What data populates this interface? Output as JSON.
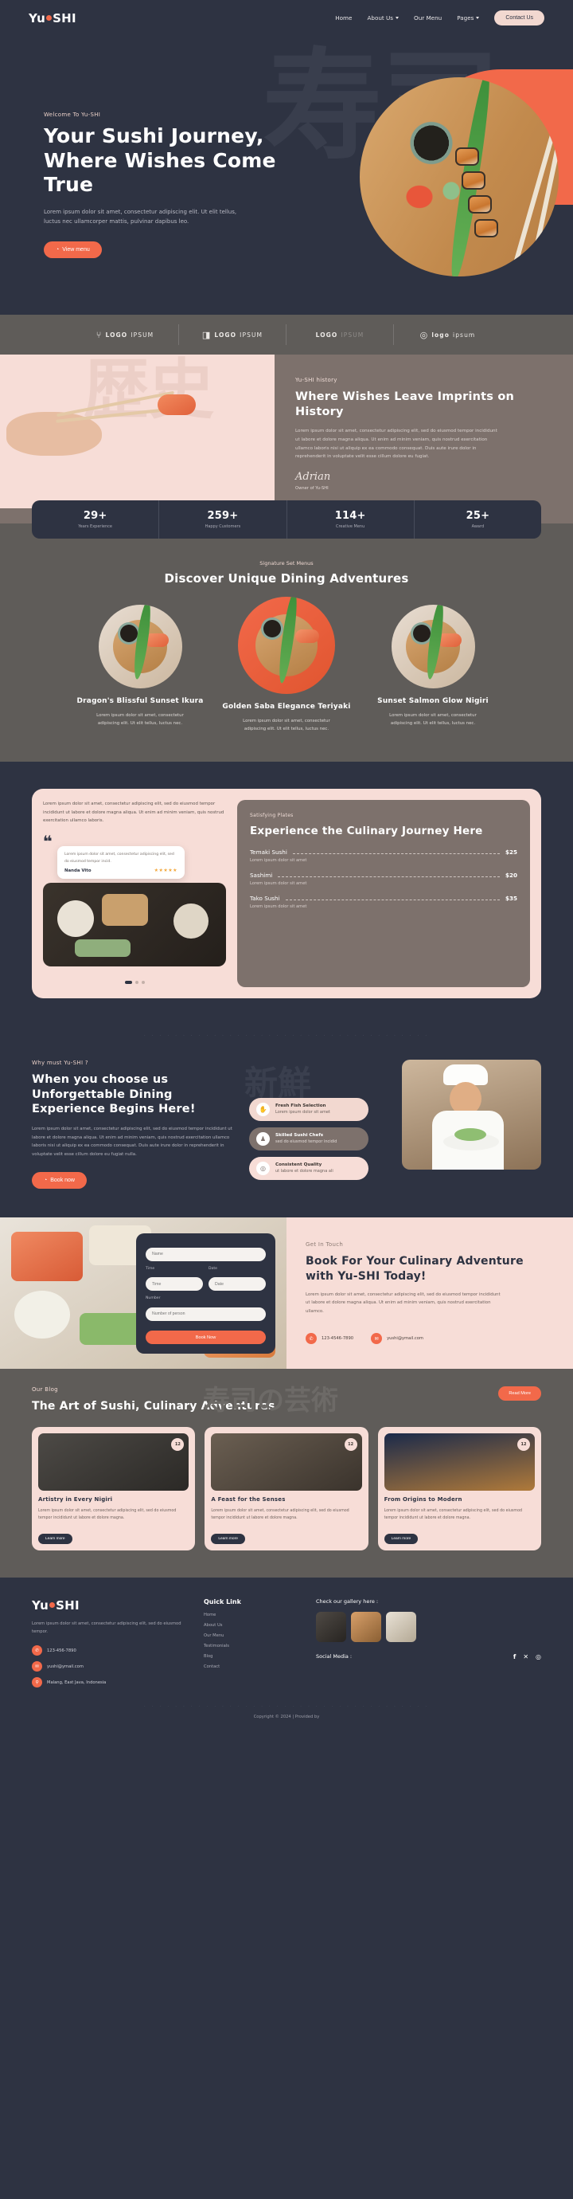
{
  "brand": {
    "pre": "Yu",
    "post": "SHI"
  },
  "nav": {
    "items": [
      {
        "label": "Home",
        "caret": false
      },
      {
        "label": "About Us",
        "caret": true
      },
      {
        "label": "Our Menu",
        "caret": false
      },
      {
        "label": "Pages",
        "caret": true
      }
    ],
    "cta": "Contact Us"
  },
  "hero": {
    "kanji": "寿司",
    "eyebrow": "Welcome To Yu-SHI",
    "title": "Your Sushi Journey, Where Wishes Come True",
    "paragraph": "Lorem ipsum dolor sit amet, consectetur adipiscing elit. Ut elit tellus, luctus nec ullamcorper mattis, pulvinar dapibus leo.",
    "button": "View menu"
  },
  "logos": [
    {
      "mark": "⑂",
      "bold": "LOGO",
      "rest": "IPSUM",
      "faded": false
    },
    {
      "mark": "◨",
      "bold": "LOGO",
      "rest": "IPSUM",
      "faded": false
    },
    {
      "mark": "",
      "bold": "LOGO",
      "rest": "IPSUM",
      "faded": true
    },
    {
      "mark": "◎",
      "bold": "logo",
      "rest": "ipsum",
      "faded": false
    }
  ],
  "history": {
    "kanji": "歴史",
    "eyebrow": "Yu-SHI history",
    "title": "Where Wishes Leave Imprints on History",
    "paragraph": "Lorem ipsum dolor sit amet, consectetur adipiscing elit, sed do eiusmod tempor incididunt ut labore et dolore magna aliqua. Ut enim ad minim veniam, quis nostrud exercitation ullamco laboris nisi ut aliquip ex ea commodo consequat. Duis aute irure dolor in reprehenderit in voluptate velit esse cillum dolore eu fugiat.",
    "signature": "Adrian",
    "owner": "Owner of Yu-SHI"
  },
  "stats": [
    {
      "num": "29+",
      "label": "Years Experience"
    },
    {
      "num": "259+",
      "label": "Happy Customers"
    },
    {
      "num": "114+",
      "label": "Creative Menu"
    },
    {
      "num": "25+",
      "label": "Award"
    }
  ],
  "menu_section": {
    "eyebrow": "Signature Set Menus",
    "title": "Discover Unique Dining Adventures",
    "cards": [
      {
        "title": "Dragon's Blissful Sunset Ikura",
        "text": "Lorem ipsum dolor sit amet, consectetur adipiscing elit. Ut elit tellus, luctus nec."
      },
      {
        "title": "Golden Saba Elegance Teriyaki",
        "text": "Lorem ipsum dolor sit amet, consectetur adipiscing elit. Ut elit tellus, luctus nec."
      },
      {
        "title": "Sunset Salmon Glow Nigiri",
        "text": "Lorem ipsum dolor sit amet, consectetur adipiscing elit. Ut elit tellus, luctus nec."
      }
    ]
  },
  "experience": {
    "lead": "Lorem ipsum dolor sit amet, consectetur adipiscing elit, sed do eiusmod tempor incididunt ut labore et dolore magna aliqua. Ut enim ad minim veniam, quis nostrud exercitation ullamco laboris.",
    "quote_mark": "❝",
    "review_text": "Lorem ipsum dolor sit amet, consectetur adipiscing elit, sed do eiusmod tempor incid.",
    "review_name": "Nanda Vito",
    "stars": "★★★★★",
    "eyebrow": "Satisfying Plates",
    "title": "Experience the Culinary Journey Here",
    "items": [
      {
        "name": "Temaki Sushi",
        "price": "$25",
        "sub": "Lorem ipsum dolor sit amet"
      },
      {
        "name": "Sashimi",
        "price": "$20",
        "sub": "Lorem ipsum dolor sit amet"
      },
      {
        "name": "Tako Sushi",
        "price": "$35",
        "sub": "Lorem ipsum dolor sit amet"
      }
    ]
  },
  "why": {
    "kanji": "新鮮",
    "eyebrow": "Why must Yu-SHI ?",
    "title": "When you choose us Unforgettable Dining Experience Begins Here!",
    "paragraph": "Lorem ipsum dolor sit amet, consectetur adipiscing elit, sed do eiusmod tempor incididunt ut labore et dolore magna aliqua. Ut enim ad minim veniam, quis nostrud exercitation ullamco laboris nisi ut aliquip ex ea commodo consequat. Duis aute irure dolor in reprehenderit in voluptate velit esse cillum dolore eu fugiat nulla.",
    "button": "Book now",
    "features": [
      {
        "icon": "✋",
        "title": "Fresh Fish Selection",
        "sub": "Lorem ipsum dolor sit amet"
      },
      {
        "icon": "♟",
        "title": "Skilled Sushi Chefs",
        "sub": "sed do eiusmod tempor incidid"
      },
      {
        "icon": "◎",
        "title": "Consistent Quality",
        "sub": "ut labore et dolore magna ali"
      }
    ]
  },
  "booking": {
    "eyebrow": "Get In Touch",
    "title": "Book For Your Culinary Adventure with Yu-SHI Today!",
    "paragraph": "Lorem ipsum dolor sit amet, consectetur adipiscing elit, sed do eiusmod tempor incididunt ut labore et dolore magna aliqua. Ut enim ad minim veniam, quis nostrud exercitation ullamco.",
    "phone": "123-4546-7890",
    "email": "yushi@ymail.com",
    "form": {
      "name_placeholder": "Name",
      "time_label": "Time",
      "date_label": "Date",
      "time_placeholder": "Time",
      "date_placeholder": "Date",
      "number_label": "Number",
      "number_placeholder": "Number of person",
      "submit": "Book Now"
    }
  },
  "blog": {
    "eyebrow": "Our Blog",
    "title": "The Art of Sushi, Culinary Adventures",
    "kanji": "寿司の芸術",
    "read_more": "Read More",
    "cards": [
      {
        "badge": "12",
        "title": "Artistry in Every Nigiri",
        "text": "Lorem ipsum dolor sit amet, consectetur adipiscing elit, sed do eiusmod tempor incididunt ut labore et dolore magna.",
        "button": "Learn more"
      },
      {
        "badge": "12",
        "title": "A Feast for the Senses",
        "text": "Lorem ipsum dolor sit amet, consectetur adipiscing elit, sed do eiusmod tempor incididunt ut labore et dolore magna.",
        "button": "Learn more"
      },
      {
        "badge": "12",
        "title": "From Origins to Modern",
        "text": "Lorem ipsum dolor sit amet, consectetur adipiscing elit, sed do eiusmod tempor incididunt ut labore et dolore magna.",
        "button": "Learn more"
      }
    ]
  },
  "footer": {
    "about": "Lorem ipsum dolor sit amet, consectetur adipiscing elit, sed do eiusmod tempor.",
    "contacts": [
      {
        "icon": "✆",
        "text": "123-456-7890"
      },
      {
        "icon": "✉",
        "text": "yushi@ymail.com"
      },
      {
        "icon": "⚲",
        "text": "Malang, East Java, Indonesia"
      }
    ],
    "quick_title": "Quick Link",
    "quick_links": [
      "Home",
      "About Us",
      "Our Menu",
      "Testimonials",
      "Blog",
      "Contact"
    ],
    "gallery_title": "Check our gallery here :",
    "social_title": "Social Media :",
    "social_icons": [
      "f",
      "✕",
      "◎"
    ],
    "copyright": "Copyright © 2024 | Provided by"
  }
}
